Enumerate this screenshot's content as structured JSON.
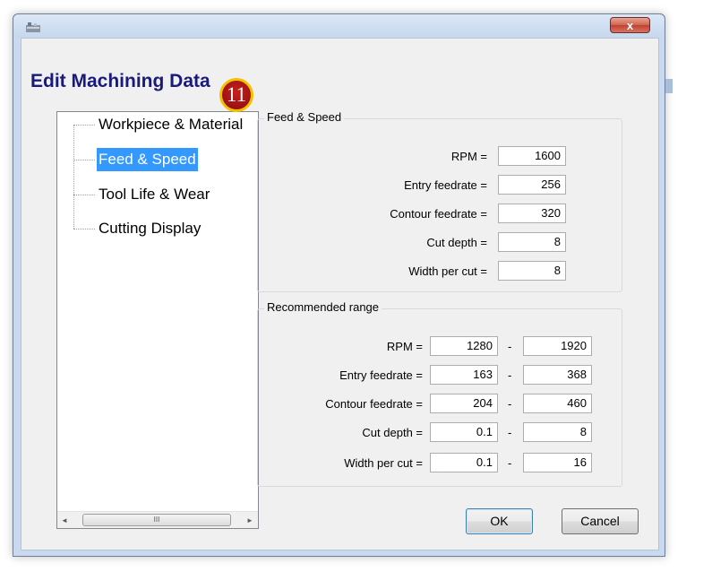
{
  "window": {
    "close_label": "x"
  },
  "dialog": {
    "title": "Edit Machining Data"
  },
  "annotation": {
    "badge": "11"
  },
  "tree": {
    "items": [
      "Workpiece & Material",
      "Feed & Speed",
      "Tool Life & Wear",
      "Cutting Display"
    ],
    "selected": "Feed & Speed",
    "scroll_left": "◄",
    "scroll_right": "►",
    "thumb_grip": "III"
  },
  "feed_speed": {
    "title": "Feed & Speed",
    "fields": [
      {
        "label": "RPM =",
        "value": "1600"
      },
      {
        "label": "Entry feedrate =",
        "value": "256"
      },
      {
        "label": "Contour feedrate =",
        "value": "320"
      },
      {
        "label": "Cut depth =",
        "value": "8"
      },
      {
        "label": "Width per cut =",
        "value": "8"
      }
    ]
  },
  "recommended": {
    "title": "Recommended range",
    "separator": "-",
    "rows": [
      {
        "label": "RPM =",
        "min": "1280",
        "max": "1920"
      },
      {
        "label": "Entry feedrate =",
        "min": "163",
        "max": "368"
      },
      {
        "label": "Contour feedrate =",
        "min": "204",
        "max": "460"
      },
      {
        "label": "Cut depth =",
        "min": "0.1",
        "max": "8"
      },
      {
        "label": "Width per cut =",
        "min": "0.1",
        "max": "16"
      }
    ]
  },
  "buttons": {
    "ok": "OK",
    "cancel": "Cancel"
  }
}
